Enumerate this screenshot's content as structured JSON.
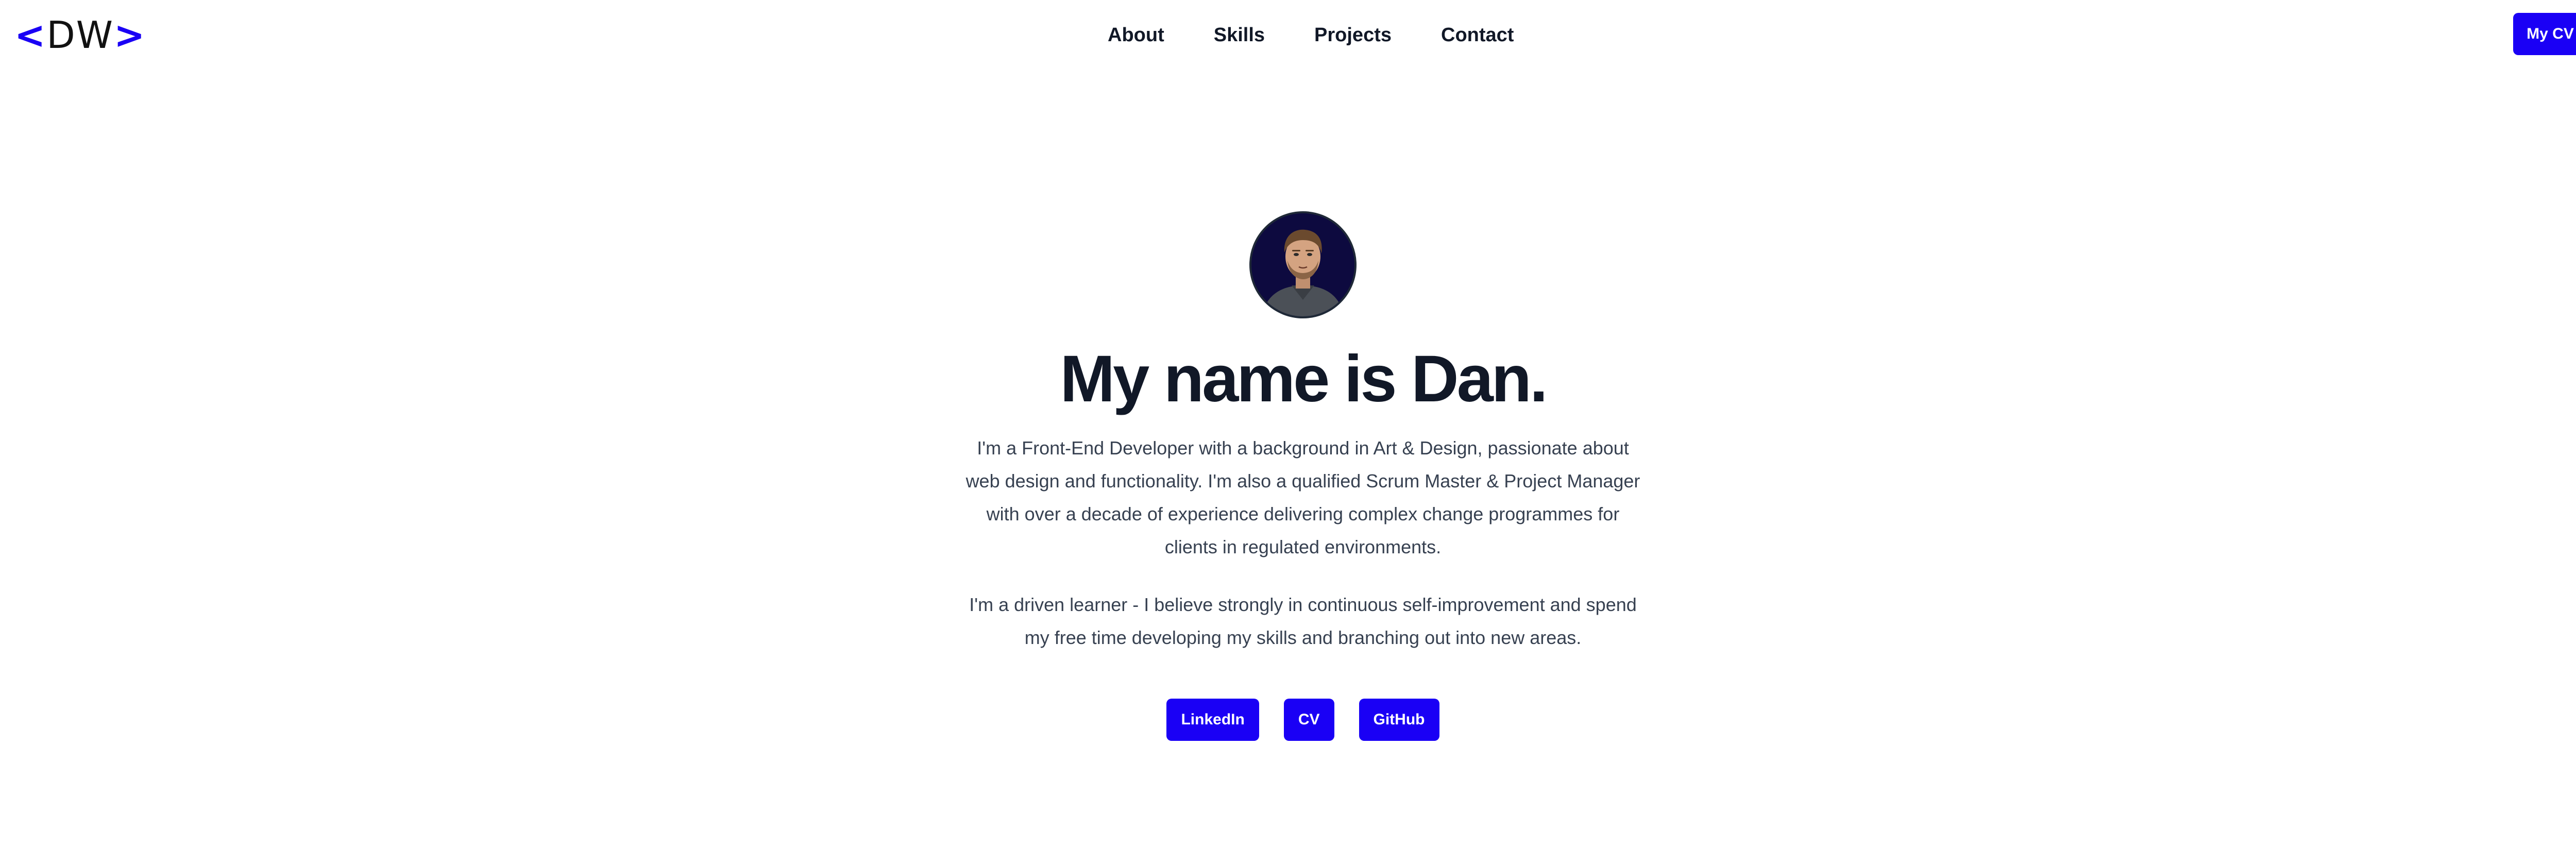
{
  "header": {
    "logo": {
      "open": "<",
      "text": "DW",
      "close": ">"
    },
    "nav": [
      {
        "label": "About"
      },
      {
        "label": "Skills"
      },
      {
        "label": "Projects"
      },
      {
        "label": "Contact"
      }
    ],
    "cv_button": "My CV"
  },
  "hero": {
    "avatar_icon": "avatar-illustration",
    "title": "My name is Dan.",
    "paragraphs": [
      "I'm a Front-End Developer with a background in Art & Design, passionate about web design and functionality. I'm also a qualified Scrum Master & Project Manager with over a decade of experience delivering complex change programmes for clients in regulated environments.",
      "I'm a driven learner - I believe strongly in continuous self-improvement and spend my free time developing my skills and branching out into new areas."
    ],
    "buttons": [
      {
        "label": "LinkedIn"
      },
      {
        "label": "CV"
      },
      {
        "label": "GitHub"
      }
    ]
  },
  "colors": {
    "accent": "#1a00f5",
    "heading": "#111827",
    "body_text": "#374151",
    "background": "#ffffff"
  }
}
